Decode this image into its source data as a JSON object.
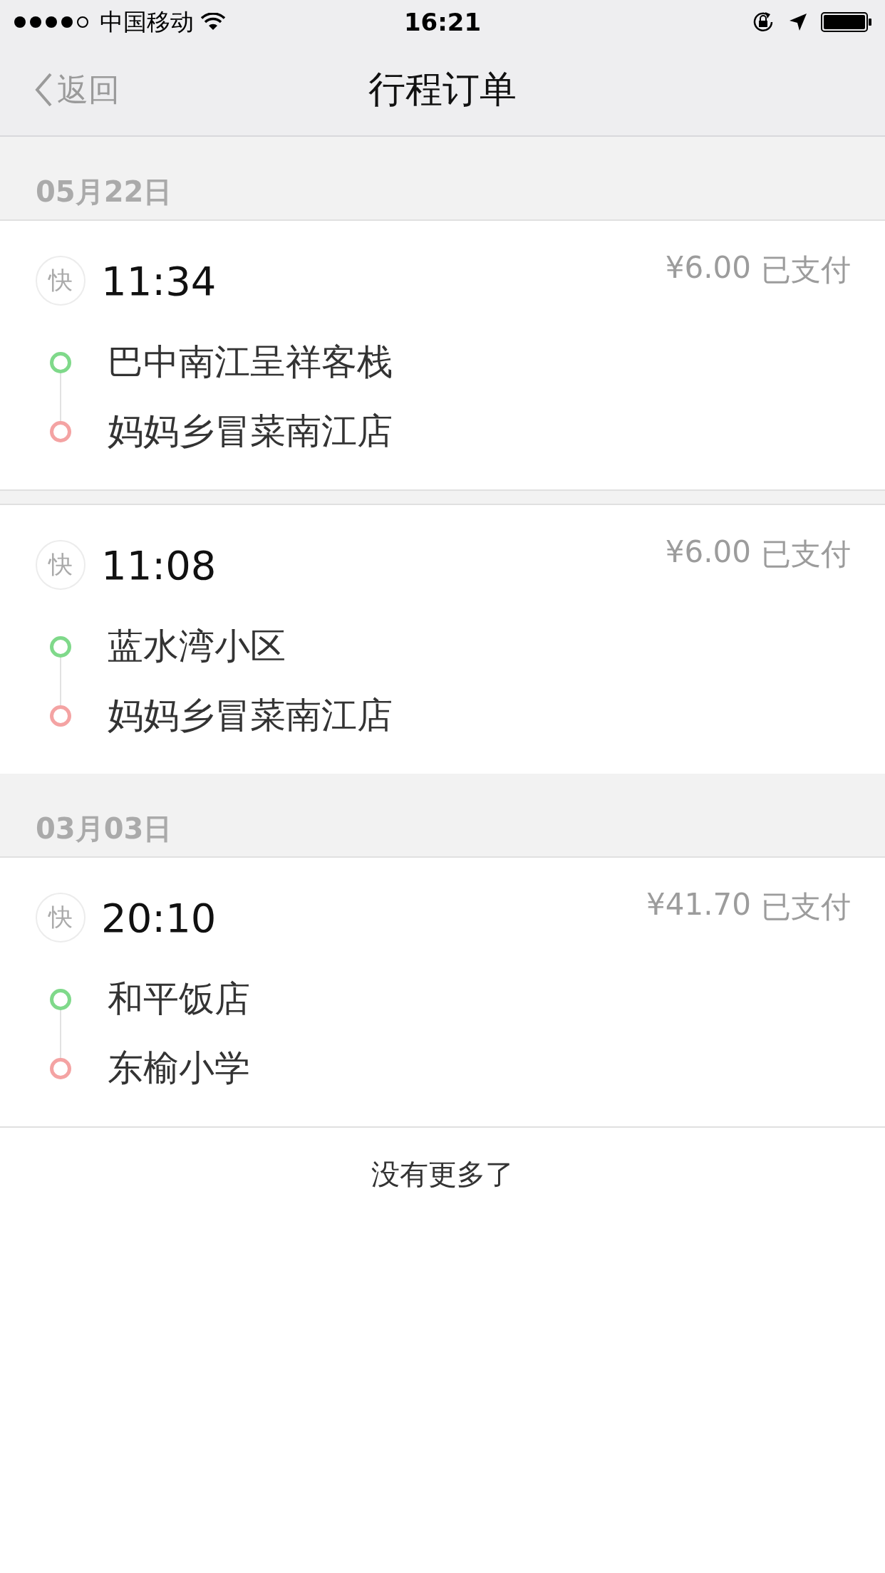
{
  "status_bar": {
    "carrier": "中国移动",
    "time": "16:21"
  },
  "nav": {
    "back": "返回",
    "title": "行程订单"
  },
  "sections": [
    {
      "date": "05月22日",
      "orders": [
        {
          "badge": "快",
          "time": "11:34",
          "price": "¥6.00",
          "status": "已支付",
          "stops": [
            {
              "kind": "start",
              "name": "巴中南江呈祥客栈"
            },
            {
              "kind": "end",
              "name": "妈妈乡冒菜南江店"
            }
          ]
        },
        {
          "badge": "快",
          "time": "11:08",
          "price": "¥6.00",
          "status": "已支付",
          "stops": [
            {
              "kind": "start",
              "name": "蓝水湾小区"
            },
            {
              "kind": "end",
              "name": "妈妈乡冒菜南江店"
            }
          ]
        }
      ]
    },
    {
      "date": "03月03日",
      "orders": [
        {
          "badge": "快",
          "time": "20:10",
          "price": "¥41.70",
          "status": "已支付",
          "stops": [
            {
              "kind": "start",
              "name": "和平饭店"
            },
            {
              "kind": "end",
              "name": "东榆小学"
            }
          ]
        }
      ]
    }
  ],
  "footer": "没有更多了"
}
